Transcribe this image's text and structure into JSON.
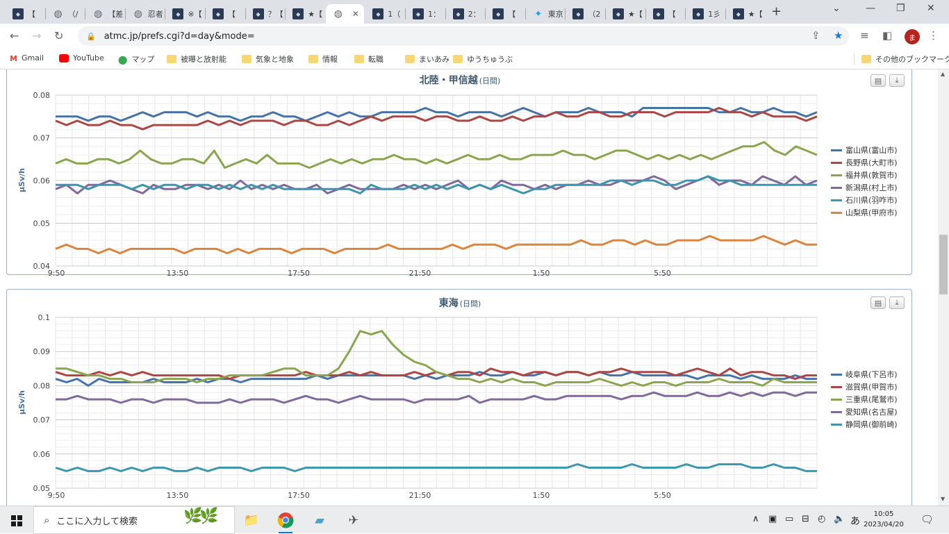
{
  "browser": {
    "tabs": [
      {
        "title": "【",
        "icon": "site-icon"
      },
      {
        "title": "（/",
        "icon": "globe-icon"
      },
      {
        "title": "【差",
        "icon": "globe-icon"
      },
      {
        "title": "忍者",
        "icon": "globe-icon"
      },
      {
        "title": "※【",
        "icon": "site-icon"
      },
      {
        "title": "【",
        "icon": "site-icon"
      },
      {
        "title": "？【",
        "icon": "site-icon"
      },
      {
        "title": "★【",
        "icon": "site-icon"
      },
      {
        "title": "",
        "icon": "globe-icon",
        "active": true
      },
      {
        "title": "1（",
        "icon": "site-icon"
      },
      {
        "title": "1：",
        "icon": "site-icon"
      },
      {
        "title": "2：",
        "icon": "site-icon"
      },
      {
        "title": "【",
        "icon": "site-icon"
      },
      {
        "title": "東京",
        "icon": "bird-icon"
      },
      {
        "title": "（2",
        "icon": "site-icon"
      },
      {
        "title": "★【",
        "icon": "site-icon"
      },
      {
        "title": "【",
        "icon": "site-icon"
      },
      {
        "title": "1彡",
        "icon": "site-icon"
      },
      {
        "title": "★【",
        "icon": "site-icon"
      }
    ],
    "new_tab": "+",
    "url": "atmc.jp/prefs.cgi?d=day&mode=",
    "profile_initial": "ま",
    "bookmarks": [
      {
        "label": "Gmail",
        "icon": "gmail-icon"
      },
      {
        "label": "YouTube",
        "icon": "youtube-icon"
      },
      {
        "label": "マップ",
        "icon": "maps-icon"
      },
      {
        "label": "被曝と放射能",
        "icon": "folder-icon"
      },
      {
        "label": "気象と地象",
        "icon": "folder-icon"
      },
      {
        "label": "情報",
        "icon": "folder-icon"
      },
      {
        "label": "転職",
        "icon": "folder-icon"
      },
      {
        "label": "まいあみ",
        "icon": "folder-icon"
      },
      {
        "label": "ゆうちゅうぶ",
        "icon": "folder-icon"
      }
    ],
    "other_bookmarks": "その他のブックマーク"
  },
  "chart_data": [
    {
      "type": "line",
      "title": "北陸・甲信越",
      "subtitle": "(日間)",
      "ylabel": "µSv/h",
      "ylim": [
        0.04,
        0.08
      ],
      "yticks": [
        "0.08",
        "0.07",
        "0.06",
        "0.05",
        "0.04"
      ],
      "xticks": [
        "9:50",
        "13:50",
        "17:50",
        "21:50",
        "1:50",
        "5:50"
      ],
      "legend_position": "right",
      "grid": true,
      "series": [
        {
          "name": "富山県(富山市)",
          "color": "#4572a7",
          "values": [
            0.075,
            0.075,
            0.075,
            0.074,
            0.075,
            0.075,
            0.074,
            0.075,
            0.076,
            0.075,
            0.076,
            0.076,
            0.076,
            0.075,
            0.076,
            0.075,
            0.075,
            0.074,
            0.075,
            0.075,
            0.076,
            0.075,
            0.075,
            0.074,
            0.075,
            0.076,
            0.075,
            0.076,
            0.075,
            0.075,
            0.076,
            0.076,
            0.076,
            0.076,
            0.077,
            0.076,
            0.076,
            0.075,
            0.076,
            0.076,
            0.076,
            0.075,
            0.076,
            0.077,
            0.076,
            0.075,
            0.076,
            0.076,
            0.076,
            0.077,
            0.076,
            0.076,
            0.076,
            0.075,
            0.077,
            0.077,
            0.077,
            0.077,
            0.077,
            0.077,
            0.077,
            0.076,
            0.076,
            0.077,
            0.076,
            0.076,
            0.077,
            0.076,
            0.076,
            0.075,
            0.076
          ]
        },
        {
          "name": "長野県(大町市)",
          "color": "#aa4643",
          "values": [
            0.074,
            0.073,
            0.074,
            0.073,
            0.073,
            0.074,
            0.073,
            0.073,
            0.072,
            0.073,
            0.073,
            0.073,
            0.073,
            0.073,
            0.074,
            0.073,
            0.074,
            0.073,
            0.074,
            0.074,
            0.074,
            0.073,
            0.074,
            0.074,
            0.073,
            0.073,
            0.074,
            0.073,
            0.074,
            0.075,
            0.074,
            0.075,
            0.075,
            0.075,
            0.074,
            0.075,
            0.075,
            0.074,
            0.074,
            0.075,
            0.074,
            0.074,
            0.075,
            0.074,
            0.075,
            0.075,
            0.076,
            0.075,
            0.075,
            0.076,
            0.076,
            0.075,
            0.075,
            0.076,
            0.076,
            0.076,
            0.075,
            0.076,
            0.076,
            0.076,
            0.076,
            0.077,
            0.076,
            0.076,
            0.075,
            0.076,
            0.075,
            0.075,
            0.075,
            0.074,
            0.075
          ]
        },
        {
          "name": "福井県(敦賀市)",
          "color": "#89a54e",
          "values": [
            0.064,
            0.065,
            0.064,
            0.064,
            0.065,
            0.065,
            0.064,
            0.065,
            0.067,
            0.065,
            0.064,
            0.064,
            0.065,
            0.065,
            0.064,
            0.067,
            0.063,
            0.064,
            0.065,
            0.064,
            0.066,
            0.064,
            0.064,
            0.064,
            0.063,
            0.064,
            0.065,
            0.064,
            0.065,
            0.064,
            0.065,
            0.065,
            0.066,
            0.065,
            0.065,
            0.064,
            0.065,
            0.064,
            0.065,
            0.066,
            0.065,
            0.065,
            0.066,
            0.065,
            0.065,
            0.066,
            0.066,
            0.066,
            0.067,
            0.066,
            0.066,
            0.065,
            0.066,
            0.067,
            0.067,
            0.066,
            0.065,
            0.066,
            0.065,
            0.066,
            0.065,
            0.066,
            0.065,
            0.066,
            0.067,
            0.068,
            0.068,
            0.069,
            0.067,
            0.066,
            0.068,
            0.067,
            0.066
          ]
        },
        {
          "name": "新潟県(村上市)",
          "color": "#80699b",
          "values": [
            0.058,
            0.059,
            0.057,
            0.059,
            0.059,
            0.06,
            0.059,
            0.058,
            0.057,
            0.059,
            0.058,
            0.058,
            0.059,
            0.059,
            0.058,
            0.059,
            0.058,
            0.06,
            0.058,
            0.059,
            0.058,
            0.059,
            0.058,
            0.058,
            0.059,
            0.057,
            0.058,
            0.059,
            0.058,
            0.058,
            0.058,
            0.058,
            0.059,
            0.058,
            0.059,
            0.058,
            0.059,
            0.06,
            0.058,
            0.059,
            0.058,
            0.06,
            0.059,
            0.059,
            0.058,
            0.059,
            0.058,
            0.059,
            0.059,
            0.06,
            0.059,
            0.059,
            0.06,
            0.06,
            0.06,
            0.061,
            0.06,
            0.058,
            0.059,
            0.06,
            0.061,
            0.059,
            0.06,
            0.06,
            0.059,
            0.061,
            0.06,
            0.059,
            0.061,
            0.059,
            0.06
          ]
        },
        {
          "name": "石川県(羽咋市)",
          "color": "#3d96ae",
          "values": [
            0.059,
            0.059,
            0.059,
            0.058,
            0.059,
            0.059,
            0.059,
            0.058,
            0.059,
            0.058,
            0.059,
            0.059,
            0.058,
            0.059,
            0.059,
            0.058,
            0.059,
            0.058,
            0.059,
            0.058,
            0.059,
            0.058,
            0.058,
            0.058,
            0.058,
            0.058,
            0.058,
            0.058,
            0.057,
            0.059,
            0.058,
            0.058,
            0.058,
            0.059,
            0.058,
            0.059,
            0.058,
            0.059,
            0.058,
            0.059,
            0.058,
            0.059,
            0.058,
            0.057,
            0.058,
            0.058,
            0.059,
            0.059,
            0.059,
            0.059,
            0.059,
            0.06,
            0.06,
            0.059,
            0.06,
            0.06,
            0.059,
            0.059,
            0.06,
            0.06,
            0.061,
            0.06,
            0.06,
            0.059,
            0.059,
            0.059,
            0.059,
            0.059,
            0.059,
            0.059,
            0.059
          ]
        },
        {
          "name": "山梨県(甲府市)",
          "color": "#db843d",
          "values": [
            0.044,
            0.045,
            0.044,
            0.044,
            0.043,
            0.044,
            0.043,
            0.044,
            0.044,
            0.044,
            0.044,
            0.044,
            0.043,
            0.044,
            0.044,
            0.044,
            0.043,
            0.044,
            0.043,
            0.044,
            0.044,
            0.044,
            0.043,
            0.044,
            0.044,
            0.044,
            0.043,
            0.044,
            0.044,
            0.044,
            0.044,
            0.045,
            0.044,
            0.044,
            0.044,
            0.044,
            0.044,
            0.045,
            0.044,
            0.045,
            0.045,
            0.045,
            0.044,
            0.045,
            0.045,
            0.045,
            0.045,
            0.045,
            0.045,
            0.046,
            0.045,
            0.045,
            0.046,
            0.046,
            0.045,
            0.046,
            0.045,
            0.045,
            0.046,
            0.046,
            0.046,
            0.047,
            0.046,
            0.046,
            0.046,
            0.046,
            0.047,
            0.046,
            0.045,
            0.046,
            0.045,
            0.045
          ]
        }
      ]
    },
    {
      "type": "line",
      "title": "東海",
      "subtitle": "(日間)",
      "ylabel": "µSv/h",
      "ylim": [
        0.05,
        0.1
      ],
      "yticks": [
        "0.1",
        "0.09",
        "0.08",
        "0.07",
        "0.06",
        "0.05"
      ],
      "xticks": [
        "9:50",
        "13:50",
        "17:50",
        "21:50",
        "1:50",
        "5:50"
      ],
      "legend_position": "right",
      "grid": true,
      "series": [
        {
          "name": "岐阜県(下呂市)",
          "color": "#4572a7",
          "values": [
            0.082,
            0.081,
            0.082,
            0.08,
            0.082,
            0.081,
            0.081,
            0.081,
            0.081,
            0.082,
            0.081,
            0.081,
            0.081,
            0.082,
            0.081,
            0.082,
            0.082,
            0.081,
            0.082,
            0.082,
            0.082,
            0.082,
            0.082,
            0.082,
            0.083,
            0.082,
            0.083,
            0.083,
            0.083,
            0.083,
            0.083,
            0.083,
            0.083,
            0.082,
            0.083,
            0.082,
            0.083,
            0.083,
            0.083,
            0.084,
            0.083,
            0.083,
            0.084,
            0.083,
            0.083,
            0.084,
            0.083,
            0.084,
            0.084,
            0.083,
            0.084,
            0.083,
            0.083,
            0.084,
            0.083,
            0.083,
            0.083,
            0.083,
            0.083,
            0.082,
            0.083,
            0.083,
            0.083,
            0.082,
            0.083,
            0.082,
            0.082,
            0.082,
            0.083,
            0.082,
            0.082
          ]
        },
        {
          "name": "滋賀県(甲賀市)",
          "color": "#aa4643",
          "values": [
            0.084,
            0.083,
            0.083,
            0.083,
            0.084,
            0.083,
            0.084,
            0.083,
            0.084,
            0.083,
            0.083,
            0.083,
            0.083,
            0.083,
            0.083,
            0.083,
            0.082,
            0.083,
            0.083,
            0.083,
            0.083,
            0.083,
            0.083,
            0.084,
            0.083,
            0.083,
            0.083,
            0.084,
            0.083,
            0.084,
            0.083,
            0.083,
            0.083,
            0.084,
            0.083,
            0.084,
            0.083,
            0.084,
            0.084,
            0.083,
            0.085,
            0.084,
            0.084,
            0.083,
            0.084,
            0.084,
            0.083,
            0.084,
            0.084,
            0.083,
            0.084,
            0.084,
            0.085,
            0.084,
            0.084,
            0.084,
            0.084,
            0.083,
            0.084,
            0.085,
            0.084,
            0.083,
            0.085,
            0.083,
            0.084,
            0.084,
            0.083,
            0.083,
            0.082,
            0.083,
            0.083
          ]
        },
        {
          "name": "三重県(尾鷲市)",
          "color": "#89a54e",
          "values": [
            0.085,
            0.085,
            0.084,
            0.083,
            0.083,
            0.082,
            0.082,
            0.081,
            0.081,
            0.081,
            0.082,
            0.082,
            0.082,
            0.081,
            0.082,
            0.082,
            0.083,
            0.083,
            0.083,
            0.083,
            0.084,
            0.085,
            0.085,
            0.083,
            0.083,
            0.083,
            0.085,
            0.09,
            0.096,
            0.095,
            0.096,
            0.092,
            0.089,
            0.087,
            0.086,
            0.084,
            0.083,
            0.082,
            0.082,
            0.081,
            0.082,
            0.081,
            0.082,
            0.081,
            0.081,
            0.08,
            0.081,
            0.081,
            0.081,
            0.081,
            0.082,
            0.081,
            0.08,
            0.081,
            0.08,
            0.081,
            0.081,
            0.08,
            0.081,
            0.081,
            0.081,
            0.082,
            0.081,
            0.081,
            0.081,
            0.08,
            0.082,
            0.081,
            0.081,
            0.081,
            0.081
          ]
        },
        {
          "name": "愛知県(名古屋)",
          "color": "#80699b",
          "values": [
            0.076,
            0.076,
            0.077,
            0.076,
            0.076,
            0.076,
            0.075,
            0.076,
            0.076,
            0.075,
            0.076,
            0.076,
            0.076,
            0.075,
            0.075,
            0.075,
            0.076,
            0.075,
            0.076,
            0.076,
            0.076,
            0.075,
            0.076,
            0.077,
            0.076,
            0.076,
            0.075,
            0.076,
            0.077,
            0.076,
            0.076,
            0.076,
            0.076,
            0.075,
            0.076,
            0.076,
            0.076,
            0.076,
            0.077,
            0.075,
            0.076,
            0.076,
            0.076,
            0.076,
            0.077,
            0.076,
            0.076,
            0.077,
            0.077,
            0.077,
            0.077,
            0.077,
            0.076,
            0.077,
            0.077,
            0.078,
            0.077,
            0.077,
            0.077,
            0.078,
            0.077,
            0.077,
            0.078,
            0.077,
            0.078,
            0.077,
            0.078,
            0.078,
            0.077,
            0.078,
            0.078
          ]
        },
        {
          "name": "静岡県(御前崎)",
          "color": "#3d96ae",
          "values": [
            0.056,
            0.055,
            0.056,
            0.055,
            0.055,
            0.056,
            0.055,
            0.056,
            0.055,
            0.056,
            0.056,
            0.055,
            0.055,
            0.056,
            0.055,
            0.056,
            0.056,
            0.056,
            0.055,
            0.056,
            0.056,
            0.056,
            0.055,
            0.056,
            0.056,
            0.056,
            0.056,
            0.056,
            0.056,
            0.056,
            0.056,
            0.056,
            0.056,
            0.056,
            0.056,
            0.056,
            0.056,
            0.056,
            0.056,
            0.056,
            0.056,
            0.056,
            0.056,
            0.056,
            0.056,
            0.056,
            0.056,
            0.056,
            0.057,
            0.056,
            0.056,
            0.056,
            0.056,
            0.057,
            0.056,
            0.056,
            0.056,
            0.056,
            0.057,
            0.056,
            0.056,
            0.057,
            0.057,
            0.057,
            0.056,
            0.056,
            0.057,
            0.056,
            0.056,
            0.055,
            0.055
          ]
        }
      ]
    }
  ],
  "taskbar": {
    "search_placeholder": "ここに入力して検索",
    "ime": "あ",
    "time": "10:05",
    "date": "2023/04/20"
  }
}
